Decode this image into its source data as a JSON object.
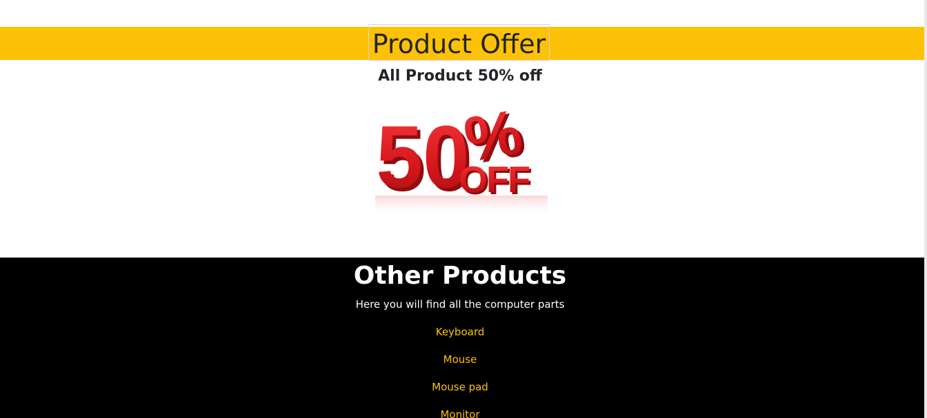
{
  "offer": {
    "title": "Product Offer",
    "subtitle": "All Product 50% off",
    "image": {
      "big_number": "50",
      "percent": "%",
      "off": "OFF"
    }
  },
  "other_products": {
    "title": "Other Products",
    "description": "Here you will find all the computer parts",
    "items": [
      {
        "label": "Keyboard"
      },
      {
        "label": "Mouse"
      },
      {
        "label": "Mouse pad"
      },
      {
        "label": "Monitor"
      }
    ]
  },
  "colors": {
    "accent_yellow": "#fdc107",
    "sale_red": "#e21e22",
    "dark_section": "#000000"
  }
}
